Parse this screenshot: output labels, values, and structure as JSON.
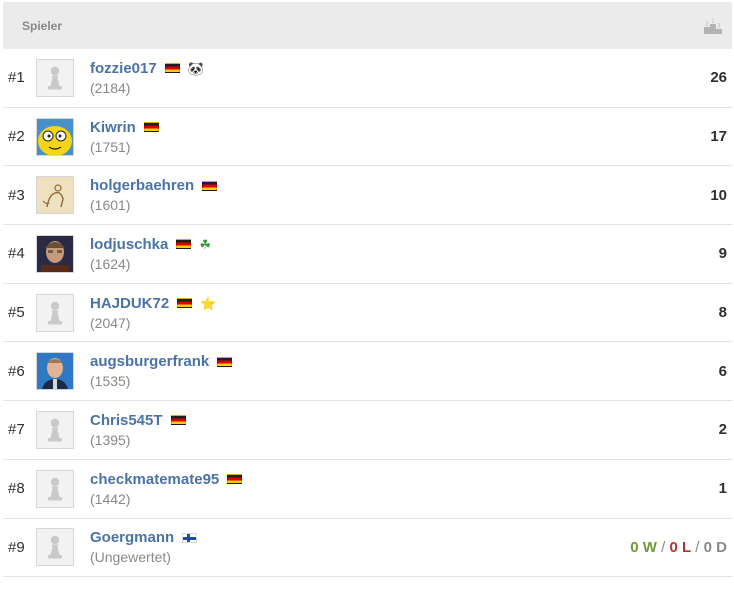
{
  "header": {
    "player_col": "Spieler",
    "score_icon": "podium-icon"
  },
  "players": [
    {
      "rank": "#1",
      "name": "fozzie017",
      "rating": "(2184)",
      "flag": "de",
      "badge": "panda-icon",
      "badge_glyph": "🐼",
      "avatar": "pawn",
      "score": "26"
    },
    {
      "rank": "#2",
      "name": "Kiwrin",
      "rating": "(1751)",
      "flag": "de",
      "badge": "",
      "badge_glyph": "",
      "avatar": "cartoon-yellow",
      "score": "17"
    },
    {
      "rank": "#3",
      "name": "holgerbaehren",
      "rating": "(1601)",
      "flag": "de",
      "badge": "",
      "badge_glyph": "",
      "avatar": "drawing-cat",
      "score": "10"
    },
    {
      "rank": "#4",
      "name": "lodjuschka",
      "rating": "(1624)",
      "flag": "de",
      "badge": "shamrock-icon",
      "badge_glyph": "☘",
      "avatar": "photo-man-1",
      "score": "9"
    },
    {
      "rank": "#5",
      "name": "HAJDUK72",
      "rating": "(2047)",
      "flag": "de",
      "badge": "star-icon",
      "badge_glyph": "⭐",
      "avatar": "pawn",
      "score": "8"
    },
    {
      "rank": "#6",
      "name": "augsburgerfrank",
      "rating": "(1535)",
      "flag": "de",
      "badge": "",
      "badge_glyph": "",
      "avatar": "photo-man-2",
      "score": "6"
    },
    {
      "rank": "#7",
      "name": "Chris545T",
      "rating": "(1395)",
      "flag": "de",
      "badge": "",
      "badge_glyph": "",
      "avatar": "pawn",
      "score": "2"
    },
    {
      "rank": "#8",
      "name": "checkmatemate95",
      "rating": "(1442)",
      "flag": "de",
      "badge": "",
      "badge_glyph": "",
      "avatar": "pawn",
      "score": "1"
    },
    {
      "rank": "#9",
      "name": "Goergmann",
      "rating": "(Ungewertet)",
      "flag": "fi",
      "badge": "",
      "badge_glyph": "",
      "avatar": "pawn",
      "wld": {
        "w": "0 W",
        "l": "0 L",
        "d": "0 D",
        "sep": "/"
      }
    }
  ],
  "colors": {
    "link": "#4a74a8",
    "win": "#6f9a3c",
    "loss": "#b33430",
    "draw": "#8b8987",
    "header_bg": "#ebebeb"
  }
}
